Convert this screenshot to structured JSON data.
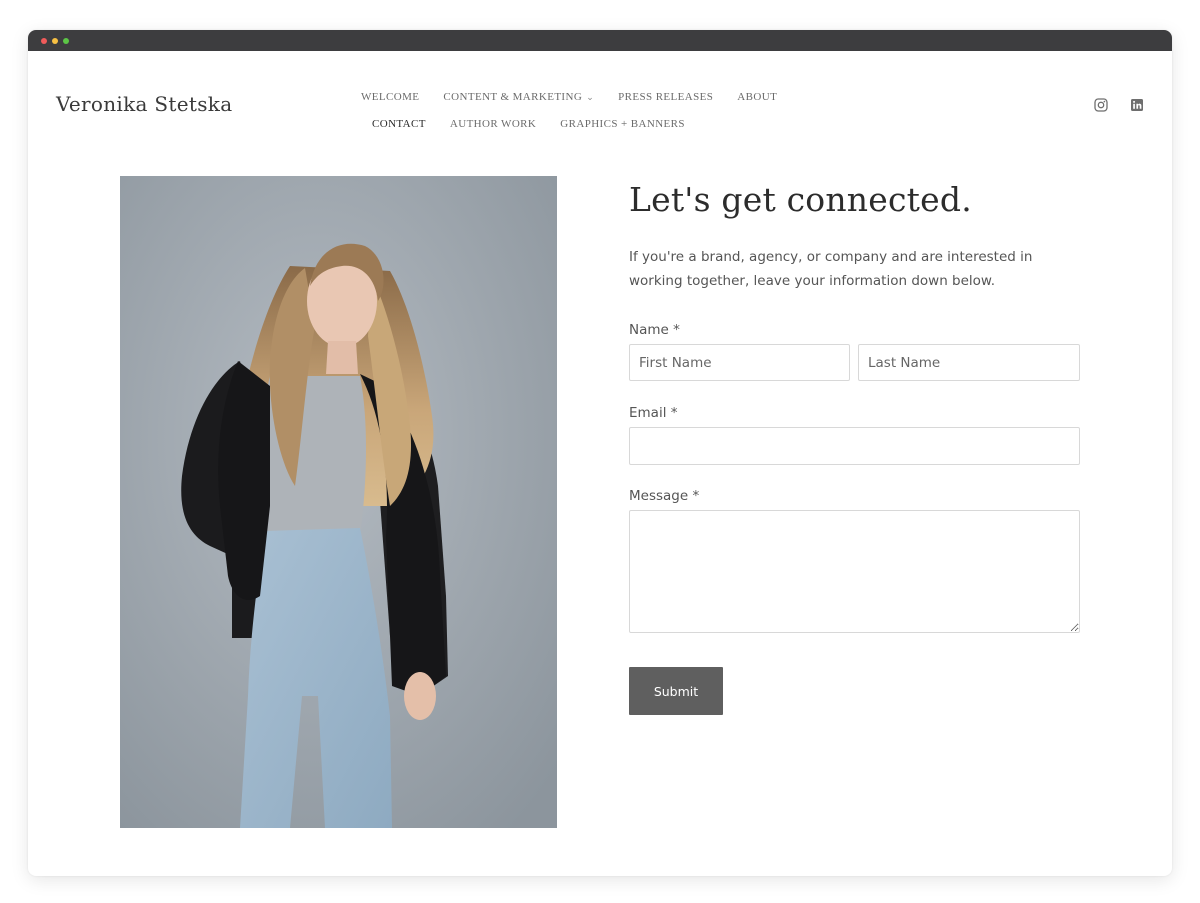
{
  "site": {
    "logo": "Veronika Stetska"
  },
  "nav": {
    "row1": [
      {
        "label": "WELCOME"
      },
      {
        "label": "CONTENT & MARKETING",
        "has_dropdown": true
      },
      {
        "label": "PRESS RELEASES"
      },
      {
        "label": "ABOUT"
      }
    ],
    "row2": [
      {
        "label": "CONTACT",
        "active": true
      },
      {
        "label": "AUTHOR WORK"
      },
      {
        "label": "GRAPHICS + BANNERS"
      }
    ],
    "dropdown_icon": "chevron-down-icon"
  },
  "social": [
    "instagram-icon",
    "linkedin-icon"
  ],
  "contact": {
    "heading": "Let's get connected.",
    "intro": "If you're a brand, agency, or company and are interested in working together, leave your information down below.",
    "name_label": "Name *",
    "first_name_placeholder": "First Name",
    "last_name_placeholder": "Last Name",
    "first_name_value": "",
    "last_name_value": "",
    "email_label": "Email *",
    "email_value": "",
    "message_label": "Message *",
    "message_value": "",
    "submit_label": "Submit"
  },
  "colors": {
    "titlebar": "#3d3d3f",
    "button": "#5f5f5f",
    "heading": "#2c2c2c",
    "body_text": "#555555"
  }
}
